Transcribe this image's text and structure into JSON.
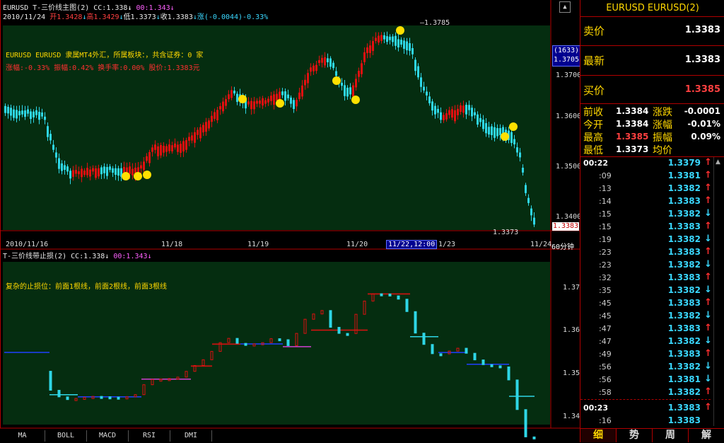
{
  "window_title": "EURUSD T-三价线主图(2) CC:1.338",
  "window_title_purple": "00:1.343",
  "ohlc_line": {
    "date": "2010/11/24",
    "open_label": "开1.3428",
    "high_label": "高1.3429",
    "low_label": "低1.3373",
    "close_label": "收1.3383",
    "change_label": "涨(-0.0044)-0.33%"
  },
  "info_line1": "EURUSD EURUSD 隶属MT4外汇，所属板块：，共含证券：0 家",
  "info_line2": "涨幅:-0.33% 振幅:0.42% 换手率:0.00% 股价:1.3383元",
  "price_marks": {
    "top_high": "1.3785",
    "low_mark": "1.3373",
    "current": "1.3383",
    "bar_count": "(1633)",
    "cursor_price": "1.3705"
  },
  "main_y_ticks": [
    "1.3700",
    "1.3600",
    "1.3500",
    "1.3400"
  ],
  "main_x_ticks": [
    "2010/11/16",
    "11/18",
    "11/19",
    "11/20",
    "11/22,12:00",
    "1/23",
    "11/24"
  ],
  "period_label": "60分钟",
  "sub_title": "T-三价线带止损(2) CC:1.338",
  "sub_title_purple": "00:1.343",
  "sub_info": "复杂的止损位：前面1根线，前面2根线，前面3根线",
  "sub_y_ticks": [
    "1.37",
    "1.36",
    "1.35",
    "1.34"
  ],
  "indicator_tabs": [
    "MA",
    "BOLL",
    "MACD",
    "RSI",
    "DMI"
  ],
  "colors": {
    "up": "#e01010",
    "down": "#2ed6e6",
    "panel_bg": "#052d10",
    "frame": "#b00000",
    "label": "#ffd700"
  },
  "right_panel": {
    "title": "EURUSD EURUSD(2)",
    "sell_label": "卖价",
    "sell_value": "1.3383",
    "latest_label": "最新",
    "latest_value": "1.3383",
    "buy_label": "买价",
    "buy_value": "1.3385",
    "stats": [
      {
        "l1": "前收",
        "v1": "1.3384",
        "l2": "涨跌",
        "v2": "-0.0001"
      },
      {
        "l1": "今开",
        "v1": "1.3384",
        "l2": "涨幅",
        "v2": "-0.01%"
      },
      {
        "l1": "最高",
        "v1": "1.3385",
        "l2": "振幅",
        "v2": "0.09%"
      },
      {
        "l1": "最低",
        "v1": "1.3373",
        "l2": "均价",
        "v2": ""
      }
    ],
    "ticks": [
      {
        "t": "00:22",
        "p": "1.3379",
        "d": "up"
      },
      {
        "t": ":09",
        "p": "1.3381",
        "d": "up"
      },
      {
        "t": ":13",
        "p": "1.3382",
        "d": "up"
      },
      {
        "t": ":14",
        "p": "1.3383",
        "d": "up"
      },
      {
        "t": ":15",
        "p": "1.3382",
        "d": "down"
      },
      {
        "t": ":15",
        "p": "1.3383",
        "d": "up"
      },
      {
        "t": ":19",
        "p": "1.3382",
        "d": "down"
      },
      {
        "t": ":23",
        "p": "1.3383",
        "d": "up"
      },
      {
        "t": ":23",
        "p": "1.3382",
        "d": "down"
      },
      {
        "t": ":32",
        "p": "1.3383",
        "d": "up"
      },
      {
        "t": ":35",
        "p": "1.3382",
        "d": "down"
      },
      {
        "t": ":45",
        "p": "1.3383",
        "d": "up"
      },
      {
        "t": ":45",
        "p": "1.3382",
        "d": "down"
      },
      {
        "t": ":47",
        "p": "1.3383",
        "d": "up"
      },
      {
        "t": ":47",
        "p": "1.3382",
        "d": "down"
      },
      {
        "t": ":49",
        "p": "1.3383",
        "d": "up"
      },
      {
        "t": ":56",
        "p": "1.3382",
        "d": "down"
      },
      {
        "t": ":56",
        "p": "1.3381",
        "d": "down"
      },
      {
        "t": ":58",
        "p": "1.3382",
        "d": "up"
      },
      {
        "t": "00:23",
        "p": "1.3383",
        "d": "up"
      },
      {
        "t": ":16",
        "p": "1.3383",
        "d": ""
      }
    ],
    "bottom_tabs": [
      "细",
      "势",
      "周",
      "解"
    ]
  }
}
